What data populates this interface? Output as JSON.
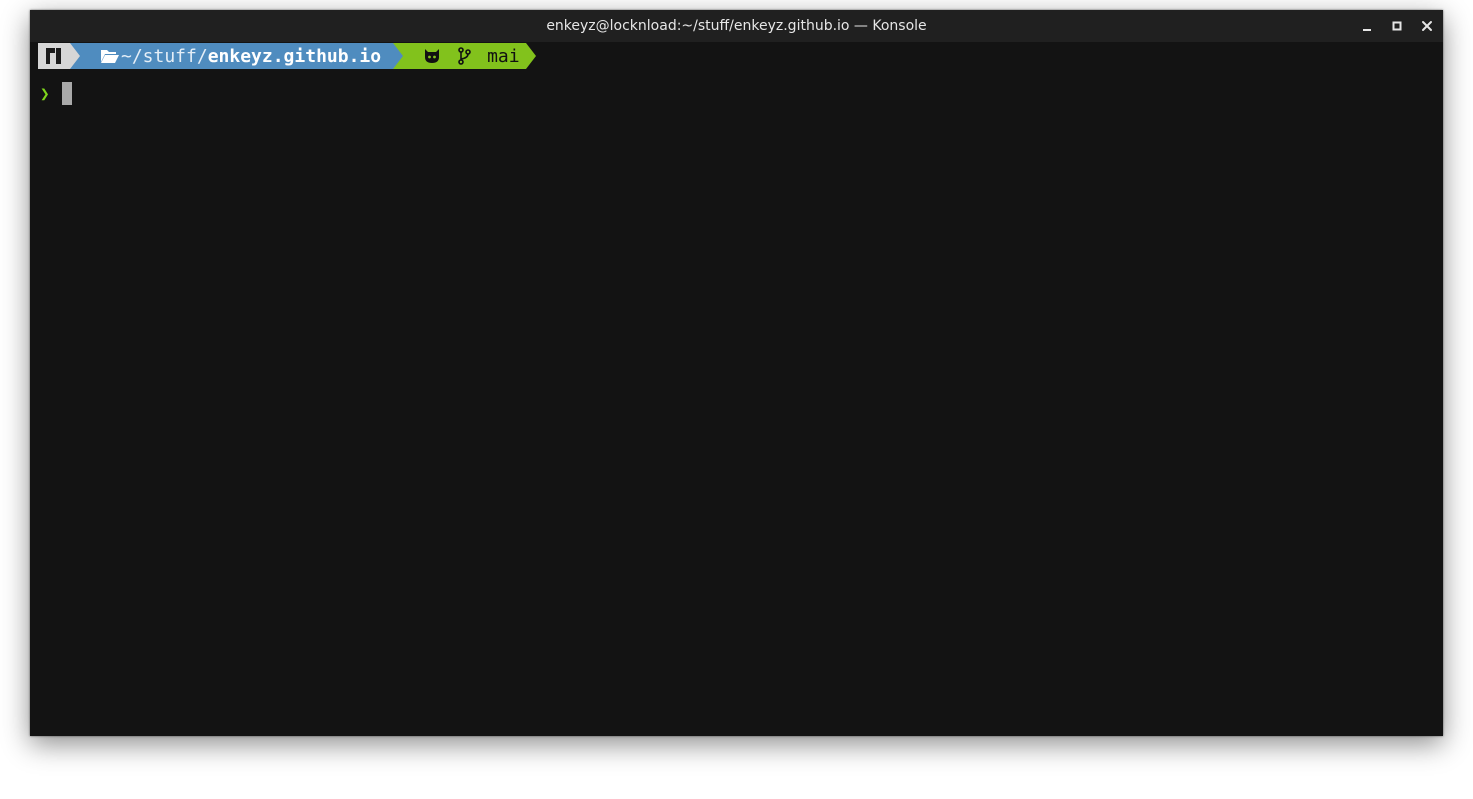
{
  "window": {
    "title": "enkeyz@locknload:~/stuff/enkeyz.github.io — Konsole"
  },
  "prompt": {
    "path_prefix": "~/stuff/",
    "path_current": "enkeyz.github.io",
    "git_branch": "mai",
    "line_symbol": "❯"
  },
  "icons": {
    "os": "manjaro-logo-icon",
    "folder": "folder-open-icon",
    "git_host": "github-octocat-icon",
    "branch": "git-branch-icon"
  },
  "colors": {
    "terminal_bg": "#131313",
    "titlebar_bg": "#202020",
    "os_segment": "#d6d6d6",
    "path_segment": "#4f8cbf",
    "git_segment": "#82c21c",
    "prompt_symbol": "#7fd61c"
  }
}
